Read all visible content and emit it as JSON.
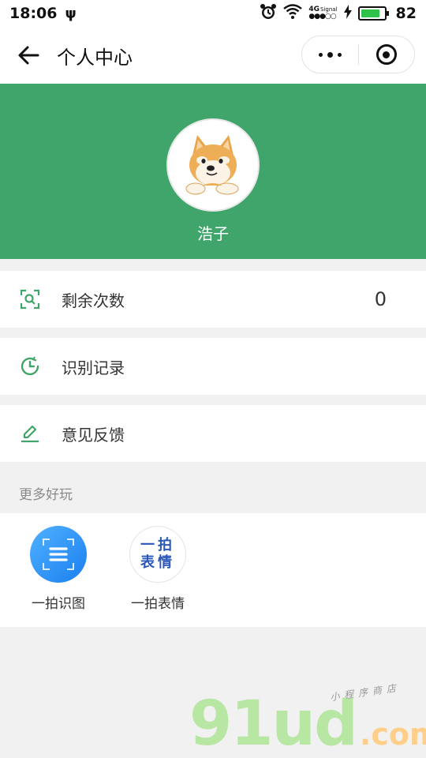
{
  "status_bar": {
    "time": "18:06",
    "usb_icon": "ψ",
    "signal_label_top": "4G",
    "signal_label_bottom": "Signal",
    "battery": "82"
  },
  "nav": {
    "title": "个人中心"
  },
  "profile": {
    "username": "浩子"
  },
  "menu": [
    {
      "label": "剩余次数",
      "value": "0",
      "icon": "scan-search-icon"
    },
    {
      "label": "识别记录",
      "icon": "clock-history-icon"
    },
    {
      "label": "意见反馈",
      "icon": "pencil-feedback-icon"
    }
  ],
  "more": {
    "title": "更多好玩",
    "apps": [
      {
        "label": "一拍识图",
        "icon": "scan-document-icon"
      },
      {
        "label": "一拍表情",
        "icon_text_top": "一拍",
        "icon_text_bottom": "表情"
      }
    ]
  },
  "watermark": {
    "main": "91ud",
    "com": ".com",
    "sub": "小程序商店"
  },
  "colors": {
    "brand_green": "#3fa56a",
    "icon_green": "#3fa56a",
    "app_blue": "#1b7ff0"
  }
}
